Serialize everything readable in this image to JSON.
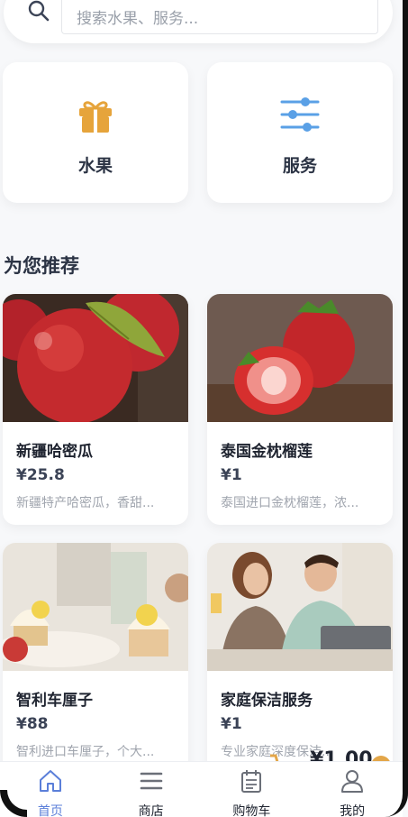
{
  "search": {
    "placeholder": "搜索水果、服务..."
  },
  "categories": [
    {
      "label": "水果",
      "icon": "gift-icon"
    },
    {
      "label": "服务",
      "icon": "sliders-icon"
    }
  ],
  "section": {
    "title": "为您推荐"
  },
  "products": [
    {
      "name": "新疆哈密瓜",
      "price": "¥25.8",
      "desc": "新疆特产哈密瓜，香甜...",
      "image": "apples-photo"
    },
    {
      "name": "泰国金枕榴莲",
      "price": "¥1",
      "desc": "泰国进口金枕榴莲，浓...",
      "image": "strawberries-photo"
    },
    {
      "name": "智利车厘子",
      "price": "¥88",
      "desc": "智利进口车厘子，个大...",
      "image": "cupcakes-photo"
    },
    {
      "name": "家庭保洁服务",
      "price": "¥1",
      "desc": "专业家庭深度保洁...",
      "image": "couple-laptop-photo"
    }
  ],
  "float_cart": {
    "price": "¥1.00"
  },
  "nav": [
    {
      "label": "首页",
      "icon": "home-icon",
      "active": true
    },
    {
      "label": "商店",
      "icon": "menu-icon",
      "active": false
    },
    {
      "label": "购物车",
      "icon": "cart-list-icon",
      "active": false
    },
    {
      "label": "我的",
      "icon": "user-icon",
      "active": false
    }
  ],
  "colors": {
    "accent": "#5b7fd9",
    "gift": "#e6a43b",
    "sliders": "#5aa0e6",
    "badge": "#e3a649"
  }
}
